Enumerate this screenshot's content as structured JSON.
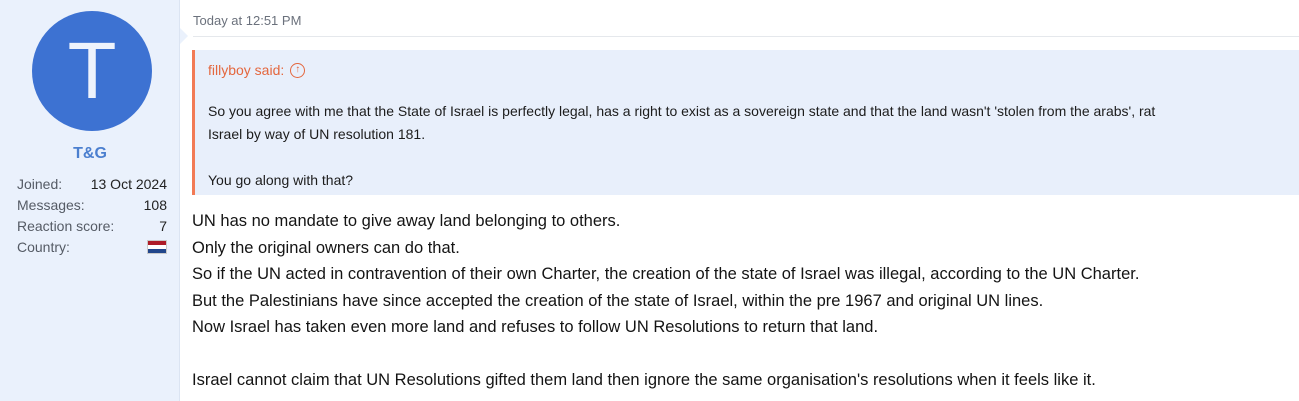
{
  "user": {
    "avatar_letter": "T",
    "avatar_color": "#3d72d2",
    "name": "T&G",
    "stats": [
      {
        "label": "Joined:",
        "value": "13 Oct 2024"
      },
      {
        "label": "Messages:",
        "value": "108"
      },
      {
        "label": "Reaction score:",
        "value": "7"
      },
      {
        "label": "Country:",
        "value": ""
      }
    ],
    "country_flag": [
      "#ae1c28",
      "#ffffff",
      "#21468b"
    ]
  },
  "post": {
    "timestamp": "Today at 12:51 PM",
    "quote": {
      "author_line": "fillyboy said:",
      "lines": [
        "So you agree with me that the State of Israel is perfectly legal, has a right to exist as a sovereign state and that the land wasn't 'stolen from the arabs', rat",
        "Israel by way of UN resolution 181.",
        "",
        "You go along with that?"
      ]
    },
    "body": [
      "UN has no mandate to give away land belonging to others.",
      "Only the original owners can do that.",
      "So if the UN acted in contravention of their own Charter, the creation of the state of Israel was illegal, according to the UN Charter.",
      "But the Palestinians have since accepted the creation of the state of Israel, within the pre 1967 and original UN lines.",
      "Now Israel has taken even more land and refuses to follow UN Resolutions to return that land.",
      "",
      "Israel cannot claim that UN Resolutions gifted them land then ignore the same organisation's resolutions when it feels like it."
    ]
  }
}
